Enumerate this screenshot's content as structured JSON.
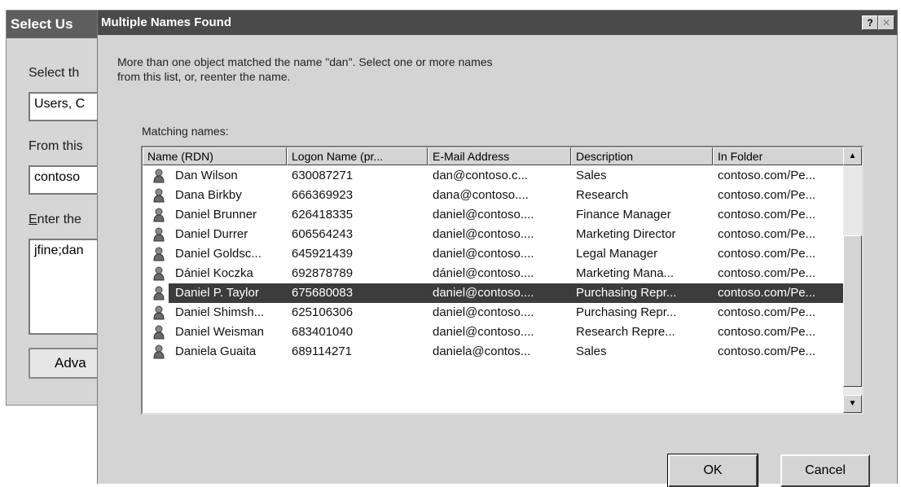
{
  "background_dialog": {
    "title": "Select Us",
    "select_this_label": "Select th",
    "object_types_value": "Users, C",
    "from_this_label": "From this",
    "location_value": "contoso",
    "enter_names_label_underlined": "E",
    "enter_names_label_rest": "nter the",
    "names_value": "jfine;dan",
    "advanced_button_label": "Adva"
  },
  "dialog": {
    "title": "Multiple Names Found",
    "help_glyph": "?",
    "close_glyph": "✕",
    "message_line1": "More than one object matched the name \"dan\". Select one or more names",
    "message_line2": "from this list, or, reenter the name.",
    "matching_label": "Matching names:",
    "columns": [
      "Name (RDN)",
      "Logon Name (pr...",
      "E-Mail Address",
      "Description",
      "In Folder"
    ],
    "rows": [
      {
        "name": "Dan Wilson",
        "logon": "630087271",
        "email": "dan@contoso.c...",
        "description": "Sales",
        "folder": "contoso.com/Pe..."
      },
      {
        "name": "Dana Birkby",
        "logon": "666369923",
        "email": "dana@contoso....",
        "description": "Research",
        "folder": "contoso.com/Pe..."
      },
      {
        "name": "Daniel Brunner",
        "logon": "626418335",
        "email": "daniel@contoso....",
        "description": "Finance Manager",
        "folder": "contoso.com/Pe..."
      },
      {
        "name": "Daniel Durrer",
        "logon": "606564243",
        "email": "daniel@contoso....",
        "description": "Marketing Director",
        "folder": "contoso.com/Pe..."
      },
      {
        "name": "Daniel Goldsc...",
        "logon": "645921439",
        "email": "daniel@contoso....",
        "description": "Legal Manager",
        "folder": "contoso.com/Pe..."
      },
      {
        "name": "Dániel Koczka",
        "logon": "692878789",
        "email": "dániel@contoso....",
        "description": "Marketing Mana...",
        "folder": "contoso.com/Pe..."
      },
      {
        "name": "Daniel P. Taylor",
        "logon": "675680083",
        "email": "daniel@contoso....",
        "description": "Purchasing Repr...",
        "folder": "contoso.com/Pe...",
        "selected": true
      },
      {
        "name": "Daniel Shimsh...",
        "logon": "625106306",
        "email": "daniel@contoso....",
        "description": "Purchasing Repr...",
        "folder": "contoso.com/Pe..."
      },
      {
        "name": "Daniel Weisman",
        "logon": "683401040",
        "email": "daniel@contoso....",
        "description": "Research Repre...",
        "folder": "contoso.com/Pe..."
      },
      {
        "name": "Daniela Guaita",
        "logon": "689114271",
        "email": "daniela@contos...",
        "description": "Sales",
        "folder": "contoso.com/Pe..."
      }
    ],
    "scroll_up_glyph": "▲",
    "scroll_down_glyph": "▼",
    "ok_label": "OK",
    "cancel_label": "Cancel"
  },
  "icons": {
    "user_icon": "user-icon"
  },
  "colors": {
    "titlebar": "#4a4a4a",
    "selection": "#3c3c3c",
    "dialog_bg": "#d4d4d4"
  }
}
